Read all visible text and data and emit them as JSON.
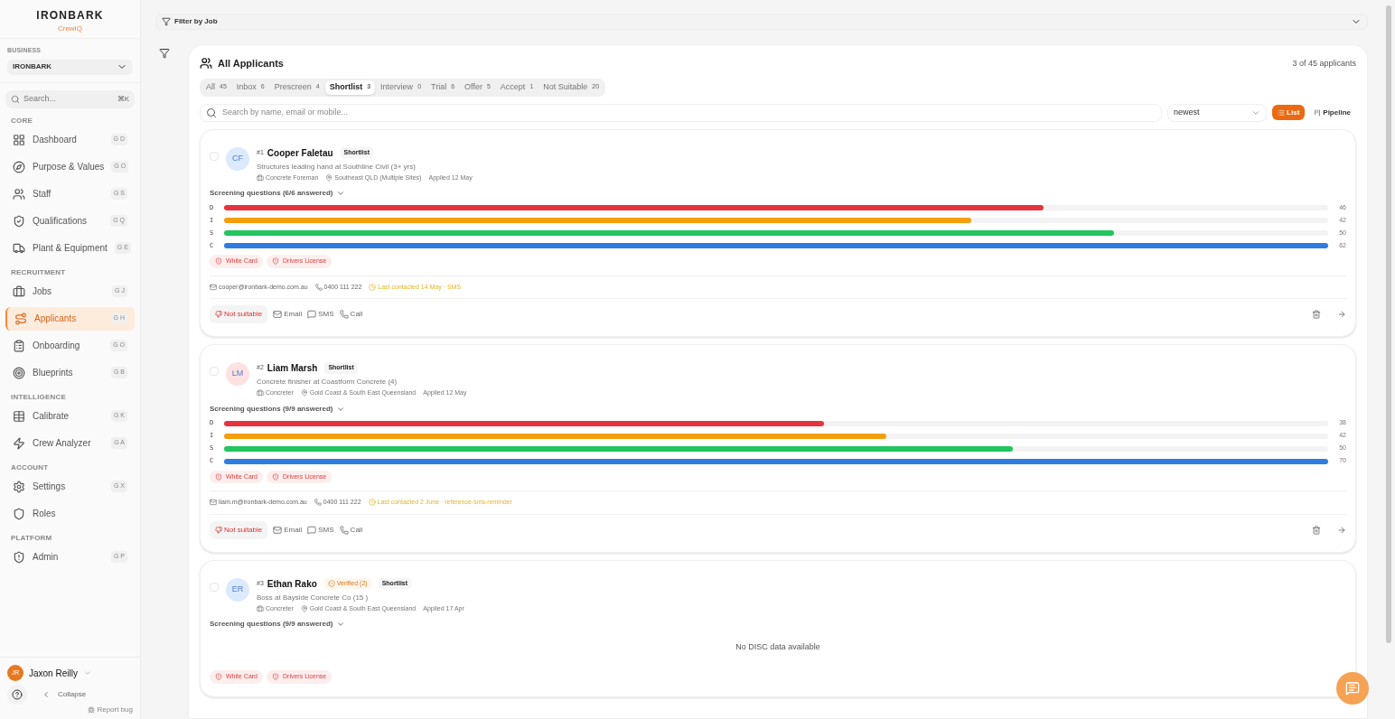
{
  "brand": {
    "name": "IRONBARK",
    "product": "CrewIQ"
  },
  "business": {
    "label": "BUSINESS",
    "value": "IRONBARK"
  },
  "sidebar_search": {
    "placeholder": "Search...",
    "shortcut": "⌘K"
  },
  "nav_sections": [
    {
      "title": "CORE",
      "items": [
        {
          "label": "Dashboard",
          "shortcut": "G D",
          "selected": false
        },
        {
          "label": "Purpose & Values",
          "shortcut": "G O",
          "selected": false
        },
        {
          "label": "Staff",
          "shortcut": "G S",
          "selected": false
        },
        {
          "label": "Qualifications",
          "shortcut": "G Q",
          "selected": false
        },
        {
          "label": "Plant & Equipment",
          "shortcut": "G E",
          "selected": false
        }
      ]
    },
    {
      "title": "RECRUITMENT",
      "items": [
        {
          "label": "Jobs",
          "shortcut": "G J",
          "selected": false
        },
        {
          "label": "Applicants",
          "shortcut": "G H",
          "selected": true
        },
        {
          "label": "Onboarding",
          "shortcut": "G O",
          "selected": false
        },
        {
          "label": "Blueprints",
          "shortcut": "G B",
          "selected": false
        }
      ]
    },
    {
      "title": "INTELLIGENCE",
      "items": [
        {
          "label": "Calibrate",
          "shortcut": "G K",
          "selected": false
        },
        {
          "label": "Crew Analyzer",
          "shortcut": "G A",
          "selected": false
        }
      ]
    },
    {
      "title": "ACCOUNT",
      "items": [
        {
          "label": "Settings",
          "shortcut": "G X",
          "selected": false
        },
        {
          "label": "Roles",
          "selected": false
        }
      ]
    },
    {
      "title": "PLATFORM",
      "items": [
        {
          "label": "Admin",
          "shortcut": "G P",
          "selected": false
        }
      ]
    }
  ],
  "user": {
    "initials": "JR",
    "name": "Jaxon Reilly"
  },
  "collapse": "Collapse",
  "report_bug": "Report bug",
  "filter_bar": {
    "label": "Filter by Job"
  },
  "panel": {
    "title": "All Applicants",
    "count": "3 of 45 applicants"
  },
  "tabs": [
    {
      "label": "All",
      "count": "45",
      "selected": false
    },
    {
      "label": "Inbox",
      "count": "6",
      "selected": false
    },
    {
      "label": "Prescreen",
      "count": "4",
      "selected": false
    },
    {
      "label": "Shortlist",
      "count": "3",
      "selected": true
    },
    {
      "label": "Interview",
      "count": "0",
      "selected": false
    },
    {
      "label": "Trial",
      "count": "6",
      "selected": false
    },
    {
      "label": "Offer",
      "count": "5",
      "selected": false
    },
    {
      "label": "Accept",
      "count": "1",
      "selected": false
    },
    {
      "label": "Not Suitable",
      "count": "20",
      "selected": false
    }
  ],
  "search": {
    "placeholder": "Search by name, email or mobile..."
  },
  "sort": {
    "value": "newest"
  },
  "views": [
    {
      "label": "List",
      "selected": true
    },
    {
      "label": "Pipeline",
      "selected": false
    }
  ],
  "applicants": [
    {
      "checked": false,
      "index": "#1",
      "initials": "CF",
      "color": "#dbeafe",
      "name": "Cooper Faletau",
      "stage": "Shortlist",
      "headline": "Structures leading hand at Southline Civil (3+ yrs)",
      "role": "Concrete Foreman",
      "location": "Southeast QLD (Multiple Sites)",
      "applied": "Applied 12 May",
      "screening": "Screening questions (6/6 answered)",
      "disc": [
        {
          "letter": "D",
          "level": 0.742,
          "value": "46",
          "color": "#e5343f"
        },
        {
          "letter": "I",
          "level": 0.677,
          "value": "42",
          "color": "#f59e0b"
        },
        {
          "letter": "S",
          "level": 0.806,
          "value": "50",
          "color": "#22c55e"
        },
        {
          "letter": "C",
          "level": 1.0,
          "value": "62",
          "color": "#2f7de1"
        }
      ],
      "tags": [
        "White Card",
        "Drivers License"
      ],
      "email": "cooper@ironbark-demo.com.au",
      "phone": "0400 111 222",
      "last_contacted": "Last contacted 14 May · SMS",
      "actions": {
        "reject": "Not suitable",
        "email": "Email",
        "sms": "SMS",
        "call": "Call"
      }
    },
    {
      "checked": false,
      "index": "#2",
      "initials": "LM",
      "color": "#fee2e2",
      "name": "Liam Marsh",
      "stage": "Shortlist",
      "headline": "Concrete finisher at Coastform Concrete (4)",
      "role": "Concreter",
      "location": "Gold Coast & South East Queensland",
      "applied": "Applied 12 May",
      "screening": "Screening questions (9/9 answered)",
      "disc": [
        {
          "letter": "D",
          "level": 0.543,
          "value": "38",
          "color": "#e5343f"
        },
        {
          "letter": "I",
          "level": 0.6,
          "value": "42",
          "color": "#f59e0b"
        },
        {
          "letter": "S",
          "level": 0.714,
          "value": "50",
          "color": "#22c55e"
        },
        {
          "letter": "C",
          "level": 1.0,
          "value": "70",
          "color": "#2f7de1"
        }
      ],
      "tags": [
        "White Card",
        "Drivers License"
      ],
      "email": "liam.m@ironbark-demo.com.au",
      "phone": "0400 111 222",
      "last_contacted": "Last contacted 2 June · reference-sms-reminder",
      "actions": {
        "reject": "Not suitable",
        "email": "Email",
        "sms": "SMS",
        "call": "Call"
      }
    },
    {
      "checked": false,
      "index": "#3",
      "initials": "ER",
      "color": "#dbeafe",
      "name": "Ethan Rako",
      "verified": "Verified (2)",
      "stage": "Shortlist",
      "headline": "Boss at Bayside Concrete Co (15 )",
      "role": "Concreter",
      "location": "Gold Coast & South East Queensland",
      "applied": "Applied 17 Apr",
      "screening": "Screening questions (9/9 answered)",
      "no_disc": "No DISC data available",
      "tags": [
        "White Card",
        "Drivers License"
      ]
    }
  ]
}
